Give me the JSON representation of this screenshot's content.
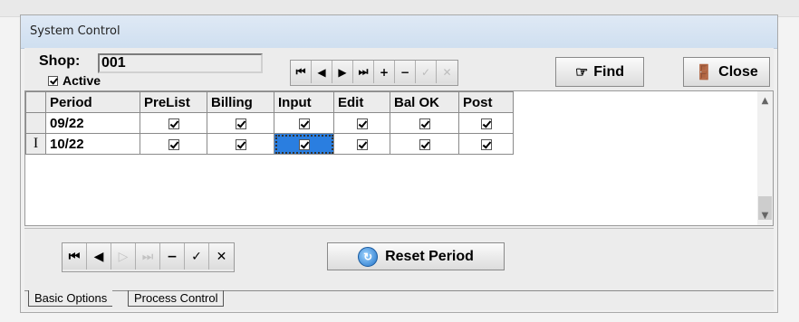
{
  "window": {
    "title": "System Control"
  },
  "header": {
    "shop_label": "Shop:",
    "shop_value": "001",
    "active_label": "Active",
    "active_checked": true
  },
  "toolbar": {
    "nav": [
      {
        "name": "first-record-button",
        "glyph": "⏮",
        "enabled": true
      },
      {
        "name": "prior-record-button",
        "glyph": "◀",
        "enabled": true
      },
      {
        "name": "next-record-button",
        "glyph": "▶",
        "enabled": true
      },
      {
        "name": "last-record-button",
        "glyph": "⏭",
        "enabled": true
      },
      {
        "name": "insert-record-button",
        "glyph": "+",
        "enabled": true
      },
      {
        "name": "delete-record-button",
        "glyph": "−",
        "enabled": true
      },
      {
        "name": "post-edit-button",
        "glyph": "✓",
        "enabled": false
      },
      {
        "name": "cancel-edit-button",
        "glyph": "✕",
        "enabled": false
      }
    ],
    "find_label": "Find",
    "close_label": "Close"
  },
  "grid": {
    "columns": [
      "Period",
      "PreList",
      "Billing",
      "Input",
      "Edit",
      "Bal OK",
      "Post"
    ],
    "rows": [
      {
        "indicator": "",
        "period": "09/22",
        "checks": [
          true,
          true,
          true,
          true,
          true,
          true
        ]
      },
      {
        "indicator": "I",
        "period": "10/22",
        "checks": [
          true,
          true,
          true,
          true,
          true,
          true
        ]
      }
    ]
  },
  "bottom_nav": {
    "buttons": [
      {
        "name": "first-button",
        "glyph": "⏮",
        "enabled": true
      },
      {
        "name": "prior-button",
        "glyph": "◀",
        "enabled": true
      },
      {
        "name": "next-button",
        "glyph": "▷",
        "enabled": false
      },
      {
        "name": "last-button",
        "glyph": "⏭",
        "enabled": false
      },
      {
        "name": "delete-button",
        "glyph": "−",
        "enabled": true
      },
      {
        "name": "post-button",
        "glyph": "✓",
        "enabled": true
      },
      {
        "name": "cancel-button",
        "glyph": "✕",
        "enabled": true
      }
    ],
    "reset_label": "Reset Period"
  },
  "tabs": [
    {
      "label": "Basic Options",
      "active": false
    },
    {
      "label": "Process Control",
      "active": true
    }
  ]
}
